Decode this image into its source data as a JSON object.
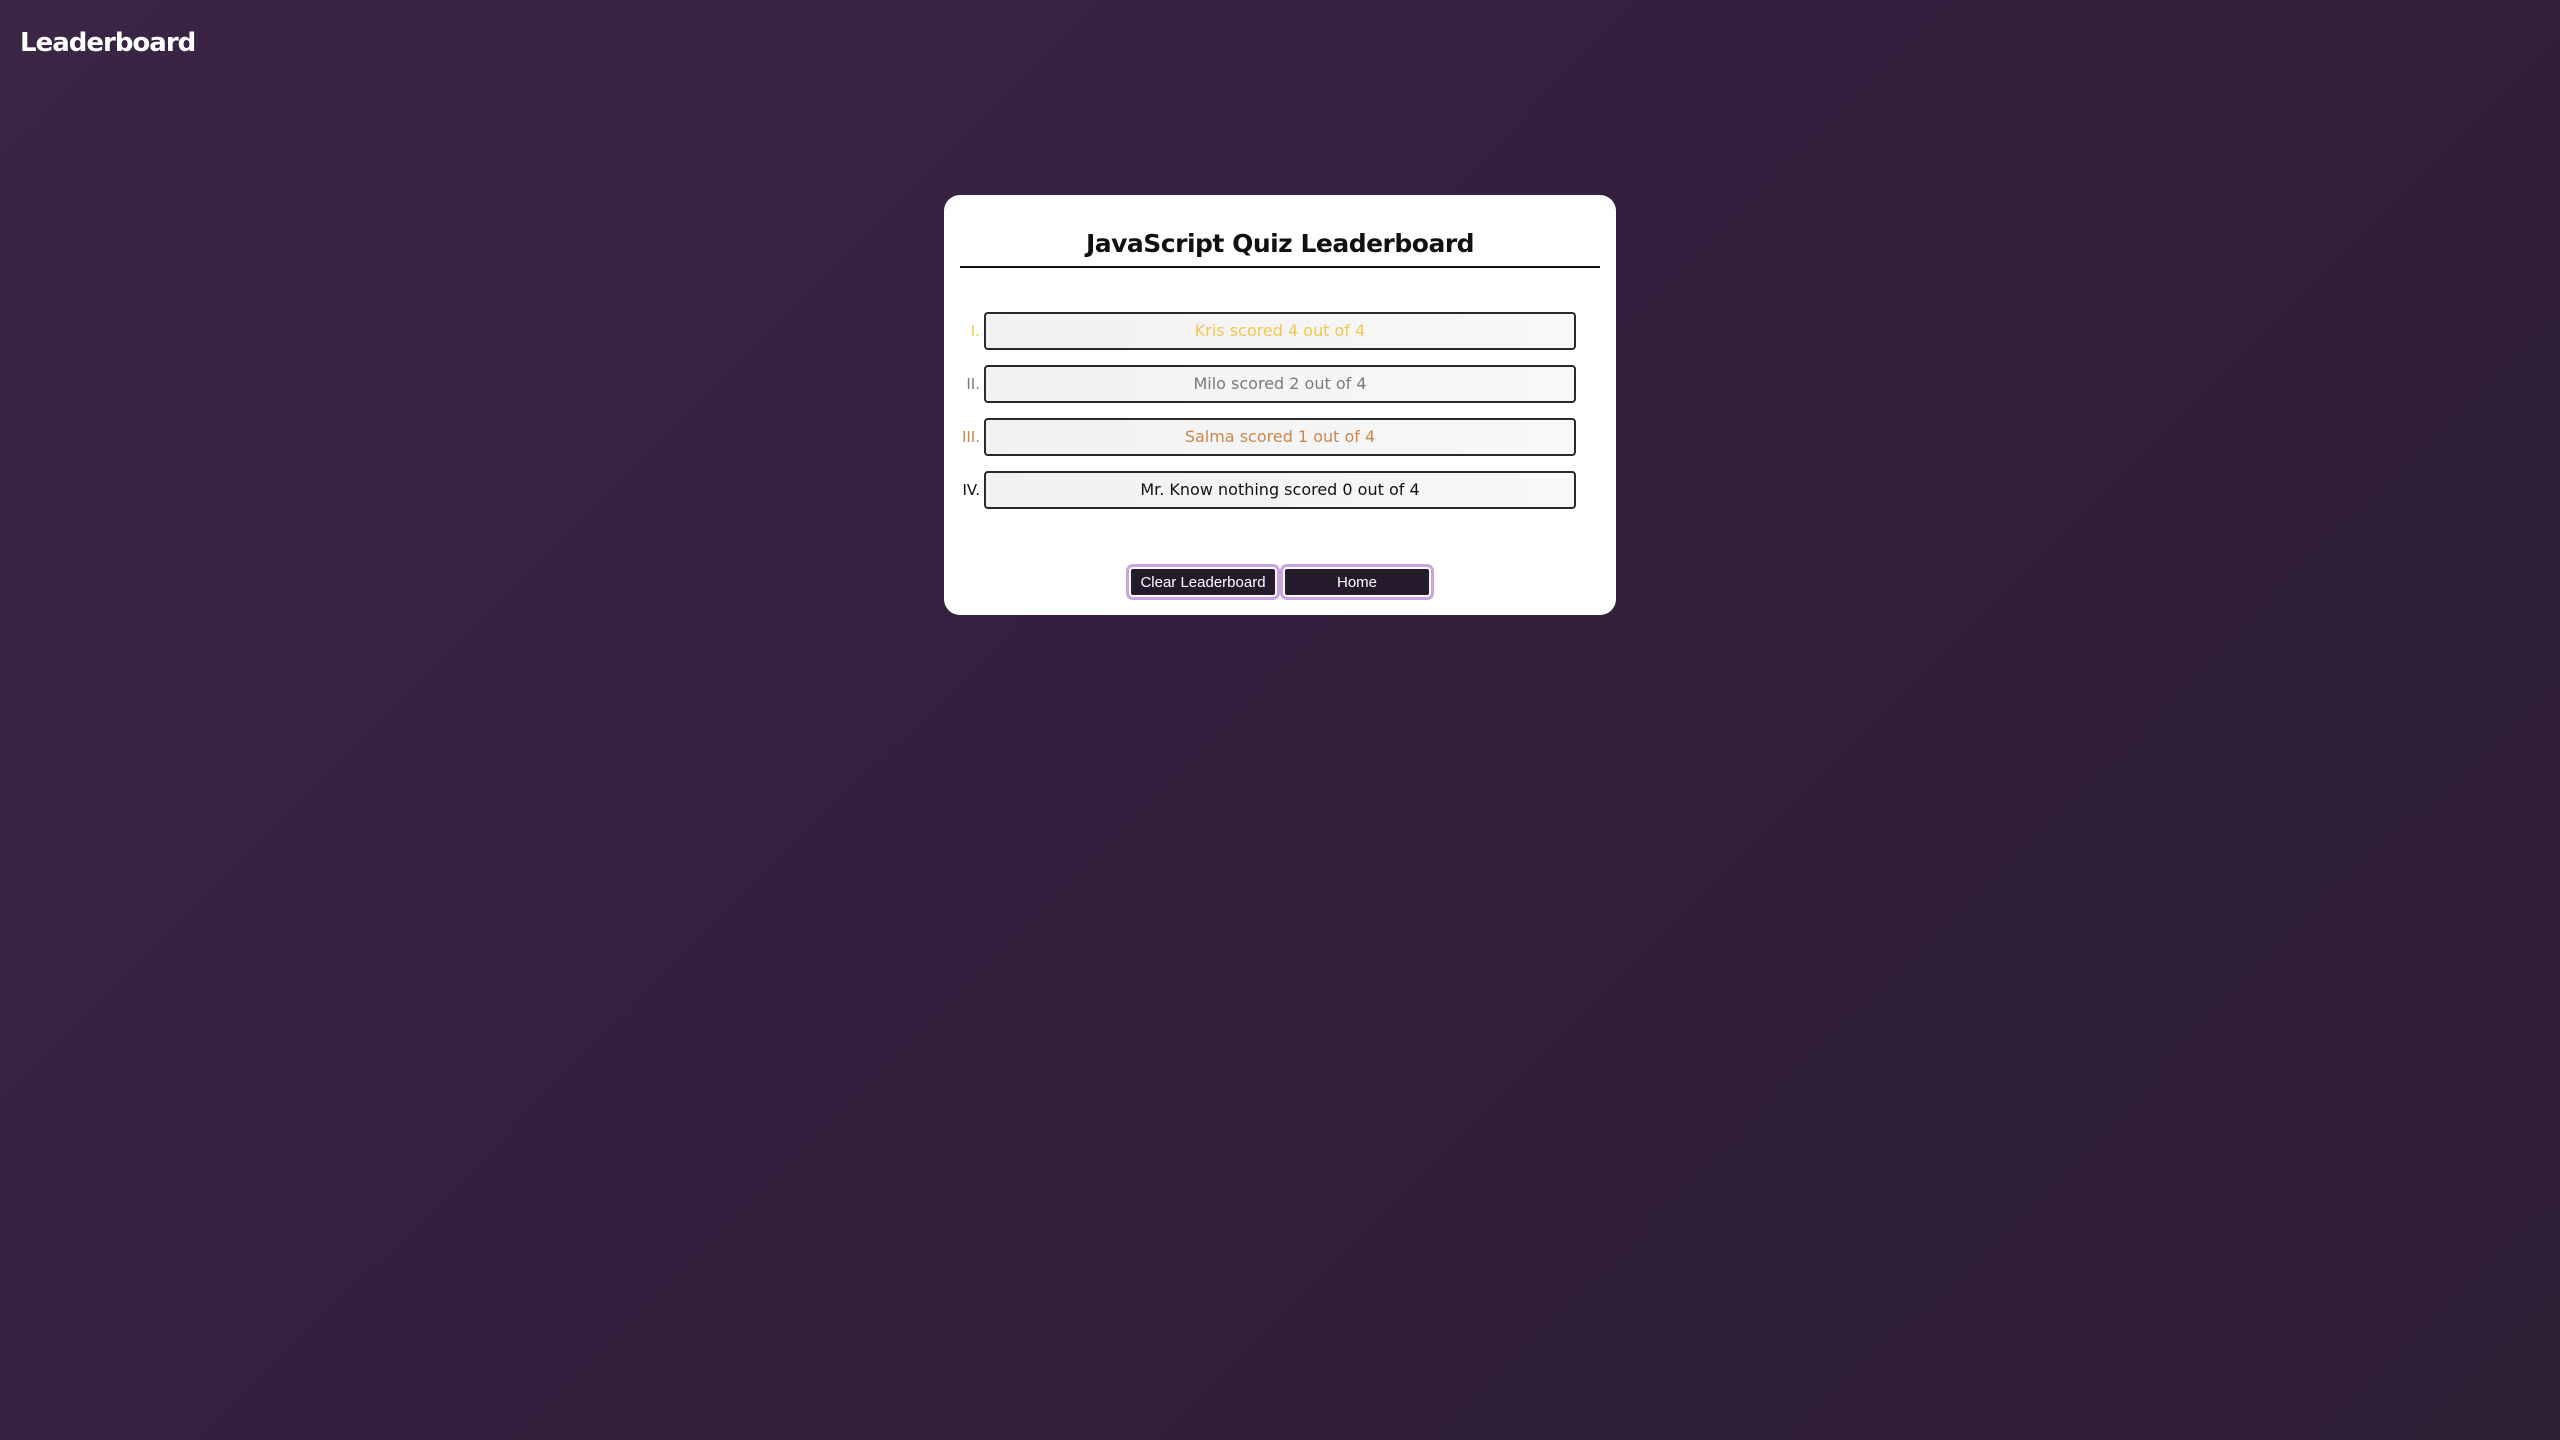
{
  "header": {
    "title": "Leaderboard"
  },
  "card": {
    "title": "JavaScript Quiz Leaderboard",
    "entries": [
      {
        "rank": "I.",
        "text": "Kris scored 4 out of 4",
        "color": "#f2c84b"
      },
      {
        "rank": "II.",
        "text": "Milo scored 2 out of 4",
        "color": "#7a7a7a"
      },
      {
        "rank": "III.",
        "text": "Salma scored 1 out of 4",
        "color": "#c9874b"
      },
      {
        "rank": "IV.",
        "text": "Mr. Know nothing scored 0 out of 4",
        "color": "#111111"
      }
    ]
  },
  "buttons": {
    "clear_label": "Clear Leaderboard",
    "home_label": "Home"
  },
  "colors": {
    "background": "#33203e",
    "card": "#ffffff",
    "button_bg": "#241a2c",
    "button_glow": "#c9a4e2"
  }
}
